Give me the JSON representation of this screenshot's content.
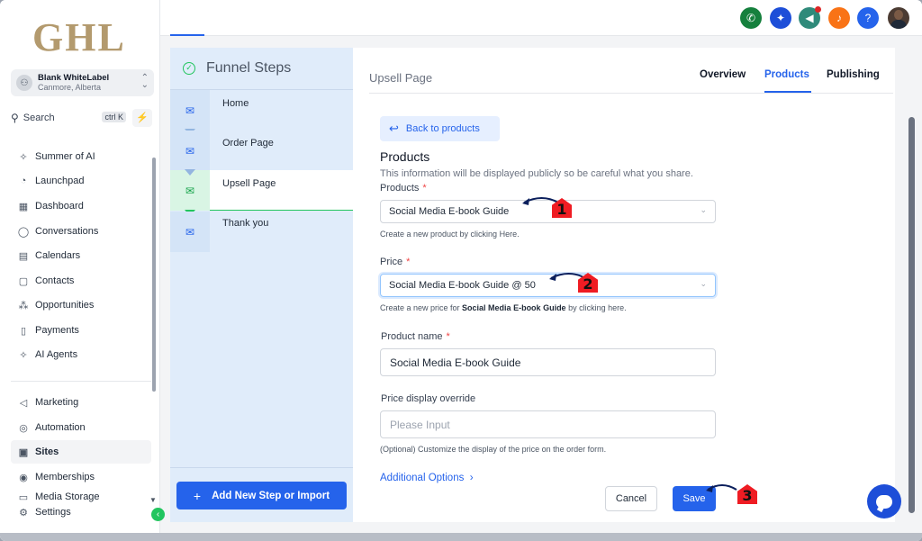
{
  "brand": {
    "logo_text": "GHL"
  },
  "account": {
    "name": "Blank WhiteLabel",
    "location": "Canmore, Alberta"
  },
  "search": {
    "label": "Search",
    "shortcut": "ctrl K"
  },
  "sidebar": {
    "items": [
      {
        "label": "Summer of AI",
        "icon": "sparkle-icon"
      },
      {
        "label": "Launchpad",
        "icon": "rocket-icon"
      },
      {
        "label": "Dashboard",
        "icon": "grid-icon"
      },
      {
        "label": "Conversations",
        "icon": "chat-icon"
      },
      {
        "label": "Calendars",
        "icon": "calendar-icon"
      },
      {
        "label": "Contacts",
        "icon": "contacts-icon"
      },
      {
        "label": "Opportunities",
        "icon": "opportunities-icon"
      },
      {
        "label": "Payments",
        "icon": "payments-icon"
      },
      {
        "label": "AI Agents",
        "icon": "sparkle-icon"
      },
      {
        "label": "Marketing",
        "icon": "marketing-icon"
      },
      {
        "label": "Automation",
        "icon": "automation-icon"
      },
      {
        "label": "Sites",
        "icon": "sites-icon"
      },
      {
        "label": "Memberships",
        "icon": "memberships-icon"
      },
      {
        "label": "Media Storage",
        "icon": "media-icon"
      },
      {
        "label": "Settings",
        "icon": "gear-icon"
      }
    ]
  },
  "topbar": {
    "buttons": [
      {
        "name": "phone",
        "color": "#15803d",
        "glyph": "✆"
      },
      {
        "name": "magic",
        "color": "#1d4ed8",
        "glyph": "✦"
      },
      {
        "name": "announce",
        "color": "#2f8a7a",
        "glyph": "◀"
      },
      {
        "name": "bell",
        "color": "#f97316",
        "glyph": "♪"
      },
      {
        "name": "help",
        "color": "#2563eb",
        "glyph": "?"
      }
    ]
  },
  "funnel": {
    "title": "Funnel Steps",
    "steps": [
      "Home",
      "Order Page",
      "Upsell Page",
      "Thank you"
    ],
    "active_index": 2,
    "add_button": "Add New Step or Import"
  },
  "page": {
    "title": "Upsell Page",
    "tabs": [
      "Overview",
      "Products",
      "Publishing"
    ],
    "active_tab": "Products"
  },
  "form": {
    "back_label": "Back to products",
    "section_title": "Products",
    "section_desc": "This information will be displayed publicly so be careful what you share.",
    "product_label": "Products",
    "product_value": "Social Media E-book Guide",
    "product_help": "Create a new product by clicking Here.",
    "price_label": "Price",
    "price_value": "Social Media E-book Guide @ 50",
    "price_help_prefix": "Create a new price for ",
    "price_help_bold": "Social Media E-book Guide",
    "price_help_suffix": " by clicking here.",
    "name_label": "Product name",
    "name_value": "Social Media E-book Guide",
    "override_label": "Price display override",
    "override_placeholder": "Please Input",
    "override_help": "(Optional) Customize the display of the price on the order form.",
    "additional": "Additional Options",
    "cancel": "Cancel",
    "save": "Save",
    "required_mark": "*"
  },
  "markers": [
    "1",
    "2",
    "3"
  ]
}
